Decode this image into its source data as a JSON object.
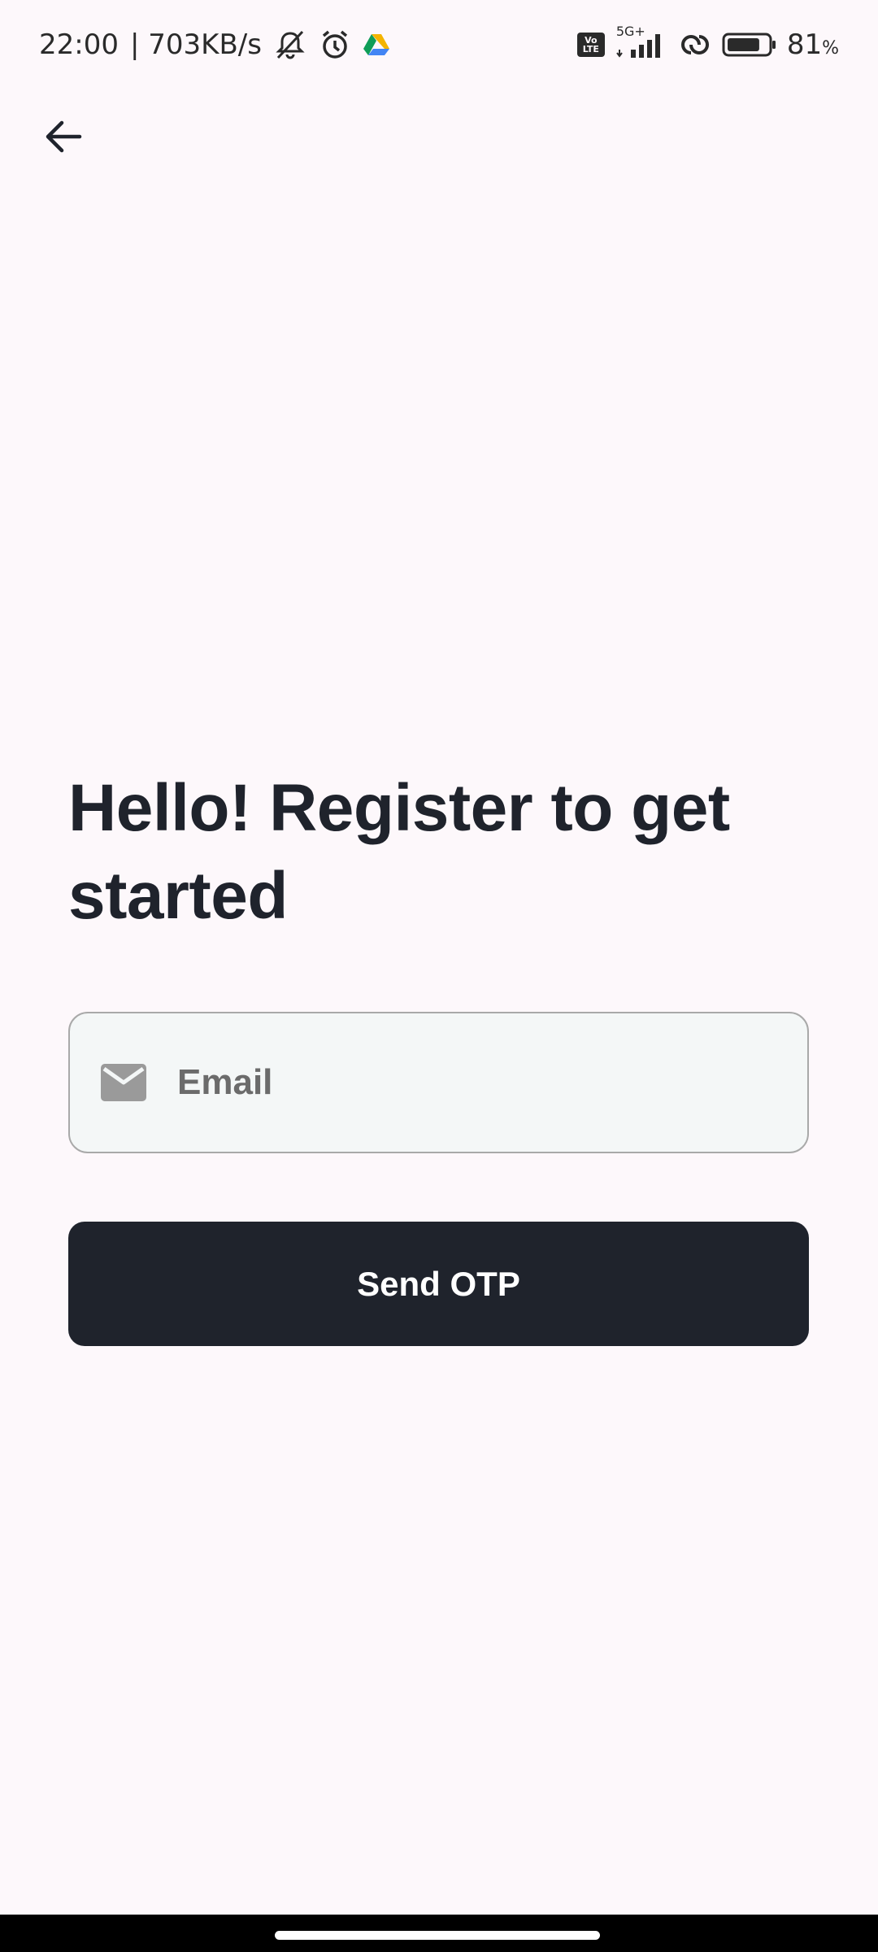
{
  "status_bar": {
    "time": "22:00",
    "network_speed": "| 703KB/s",
    "volte_top": "Vo",
    "volte_bottom": "LTE",
    "network_type": "5G+",
    "battery_percent": "81",
    "battery_unit": "%",
    "battery_level": 0.81,
    "icons": [
      "muted-bell-icon",
      "alarm-icon",
      "drive-icon",
      "volte-icon",
      "signal-icon",
      "hotspot-icon",
      "battery-icon"
    ]
  },
  "header": {
    "back_icon": "arrow-left-icon"
  },
  "main": {
    "title": "Hello! Register to get started",
    "email_field": {
      "placeholder": "Email",
      "value": "",
      "icon": "mail-icon"
    },
    "send_otp_label": "Send OTP"
  },
  "colors": {
    "background": "#fdf8fb",
    "primary": "#1f232c",
    "field_background": "#f4f7f7",
    "field_border": "#a9a9a9",
    "icon_gray": "#9a9a9a"
  }
}
